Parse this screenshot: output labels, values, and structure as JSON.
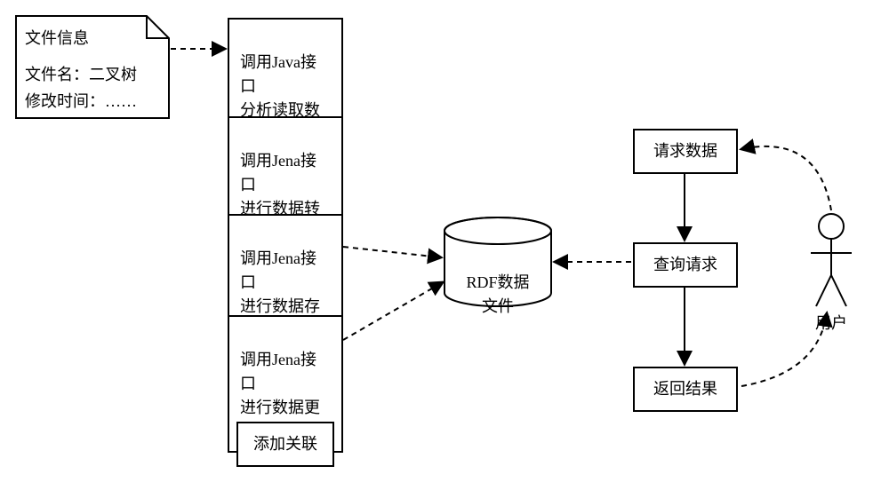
{
  "chart_data": {
    "type": "diagram",
    "title": "",
    "nodes": [
      {
        "id": "file-info",
        "shape": "note",
        "text": "文件信息\n\n文件名：二叉树\n修改时间：……"
      },
      {
        "id": "java-read",
        "shape": "rect",
        "text": "调用Java接口\n分析读取数据"
      },
      {
        "id": "jena-convert",
        "shape": "rect",
        "text": "调用Jena接口\n进行数据转换"
      },
      {
        "id": "jena-store",
        "shape": "rect",
        "text": "调用Jena接口\n进行数据存储"
      },
      {
        "id": "jena-update",
        "shape": "rect",
        "text": "调用Jena接口\n进行数据更新"
      },
      {
        "id": "add-relation",
        "shape": "rect",
        "text": "添加关联"
      },
      {
        "id": "rdf-file",
        "shape": "cylinder",
        "text": "RDF数据\n文件"
      },
      {
        "id": "request-data",
        "shape": "rect",
        "text": "请求数据"
      },
      {
        "id": "query-request",
        "shape": "rect",
        "text": "查询请求"
      },
      {
        "id": "return-result",
        "shape": "rect",
        "text": "返回结果"
      },
      {
        "id": "user",
        "shape": "actor",
        "text": "用户"
      }
    ],
    "edges": [
      {
        "from": "file-info",
        "to": "java-read",
        "style": "dashed"
      },
      {
        "from": "java-read",
        "to": "jena-convert",
        "style": "solid"
      },
      {
        "from": "jena-convert",
        "to": "jena-store",
        "style": "solid"
      },
      {
        "from": "jena-store",
        "to": "rdf-file",
        "style": "dashed"
      },
      {
        "from": "jena-update",
        "to": "rdf-file",
        "style": "dashed"
      },
      {
        "from": "add-relation",
        "to": "jena-update",
        "style": "solid"
      },
      {
        "from": "query-request",
        "to": "rdf-file",
        "style": "dashed"
      },
      {
        "from": "request-data",
        "to": "query-request",
        "style": "solid"
      },
      {
        "from": "query-request",
        "to": "return-result",
        "style": "solid"
      },
      {
        "from": "user",
        "to": "request-data",
        "style": "dashed"
      },
      {
        "from": "return-result",
        "to": "user",
        "style": "dashed"
      }
    ]
  },
  "nodes": {
    "file_info": {
      "line1": "文件信息",
      "line2": "文件名：二叉树",
      "line3": "修改时间：……"
    },
    "java_read": {
      "text": "调用Java接口\n分析读取数据"
    },
    "jena_convert": {
      "text": "调用Jena接口\n进行数据转换"
    },
    "jena_store": {
      "text": "调用Jena接口\n进行数据存储"
    },
    "jena_update": {
      "text": "调用Jena接口\n进行数据更新"
    },
    "add_relation": {
      "text": "添加关联"
    },
    "rdf_file": {
      "text": "RDF数据\n文件"
    },
    "request_data": {
      "text": "请求数据"
    },
    "query_request": {
      "text": "查询请求"
    },
    "return_result": {
      "text": "返回结果"
    },
    "user": {
      "text": "用户"
    }
  }
}
